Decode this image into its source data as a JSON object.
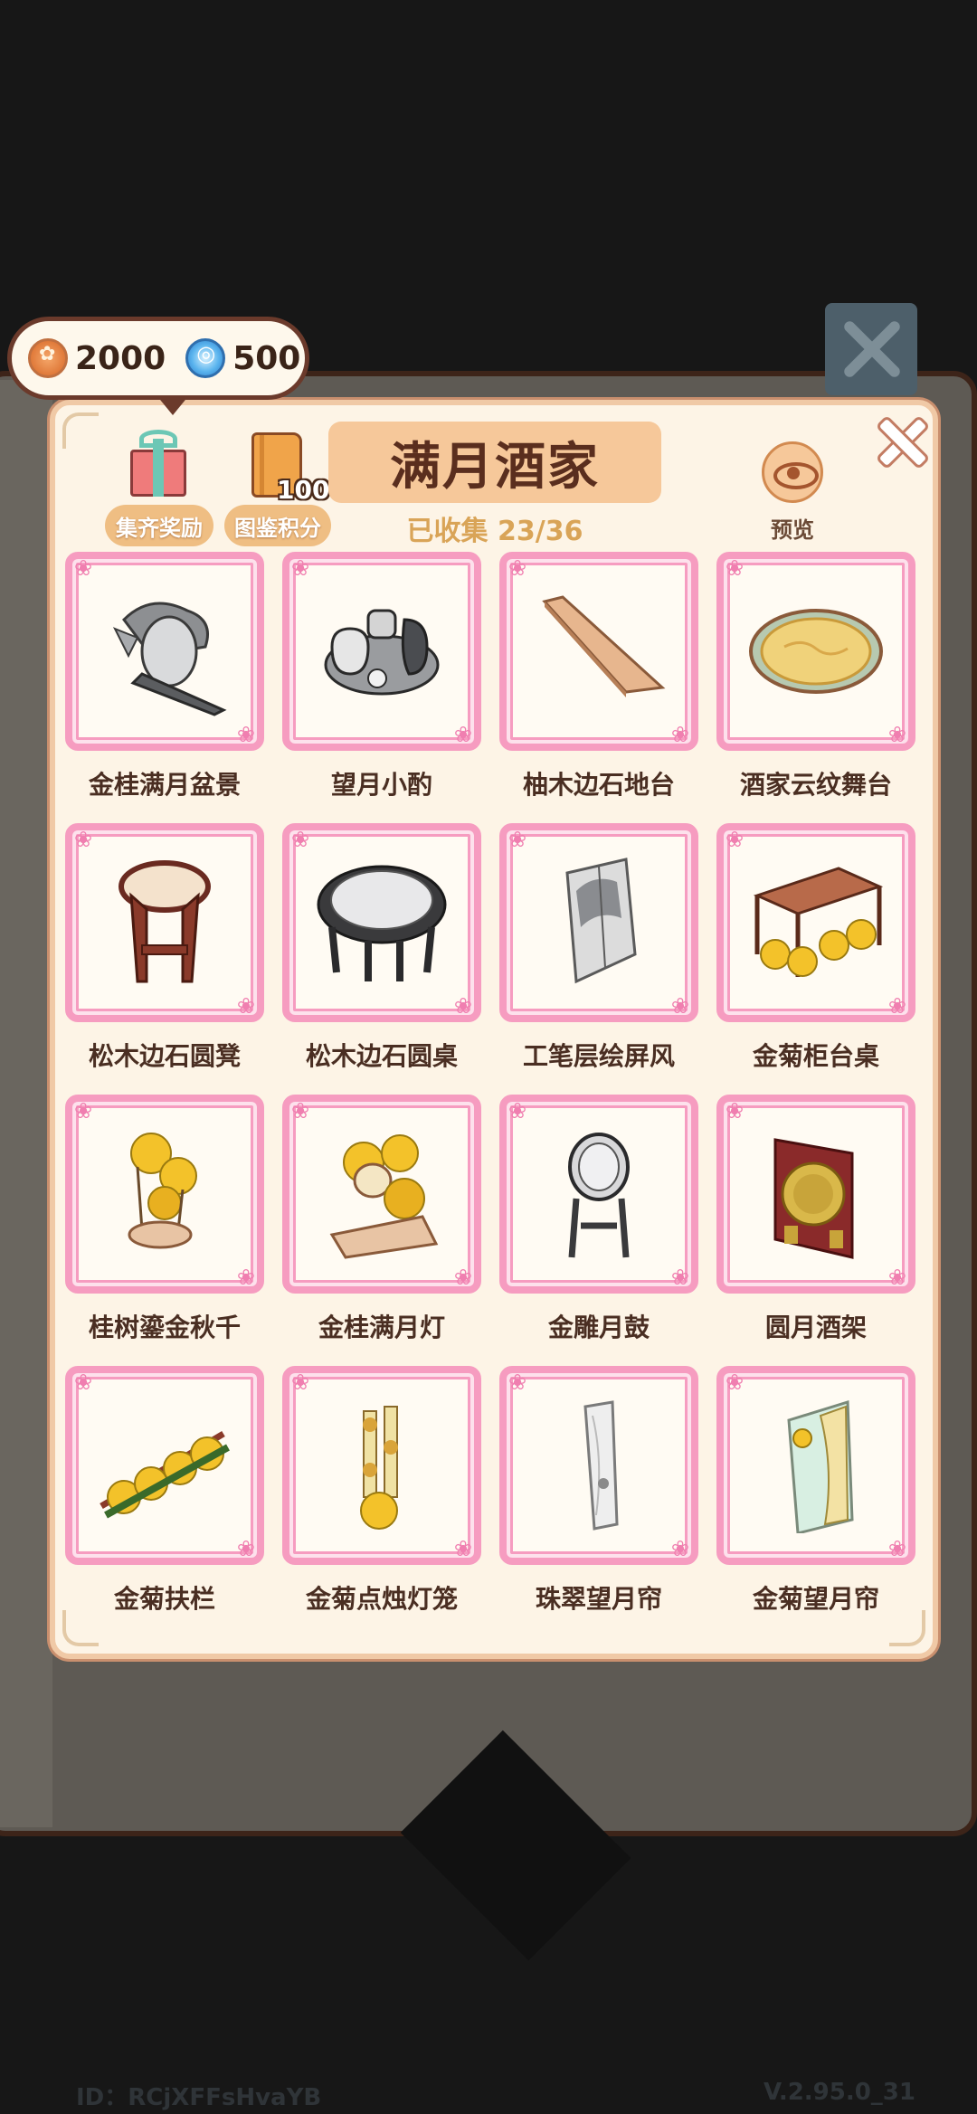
{
  "currency": {
    "coins": "2000",
    "gems": "500"
  },
  "header": {
    "reward_label": "集齐奖励",
    "book_count": "100",
    "points_label": "图鉴积分",
    "title": "满月酒家",
    "progress": "已收集 23/36",
    "preview_label": "预览"
  },
  "items": [
    {
      "label": "金桂满月盆景",
      "icon": "bonsai-screen-icon"
    },
    {
      "label": "望月小酌",
      "icon": "tea-set-icon"
    },
    {
      "label": "柚木边石地台",
      "icon": "wood-platform-icon"
    },
    {
      "label": "酒家云纹舞台",
      "icon": "round-stage-icon"
    },
    {
      "label": "松木边石圆凳",
      "icon": "round-stool-icon"
    },
    {
      "label": "松木边石圆桌",
      "icon": "round-table-icon"
    },
    {
      "label": "工笔层绘屏风",
      "icon": "folding-screen-icon"
    },
    {
      "label": "金菊柜台桌",
      "icon": "counter-table-icon"
    },
    {
      "label": "桂树鎏金秋千",
      "icon": "swing-icon"
    },
    {
      "label": "金桂满月灯",
      "icon": "moon-lamp-icon"
    },
    {
      "label": "金雕月鼓",
      "icon": "drum-icon"
    },
    {
      "label": "圆月酒架",
      "icon": "wine-rack-icon"
    },
    {
      "label": "金菊扶栏",
      "icon": "railing-icon"
    },
    {
      "label": "金菊点烛灯笼",
      "icon": "lantern-icon"
    },
    {
      "label": "珠翠望月帘",
      "icon": "white-curtain-icon"
    },
    {
      "label": "金菊望月帘",
      "icon": "gold-curtain-icon"
    }
  ],
  "footer": {
    "id": "ID：RCjXFFsHvaYB",
    "version": "V.2.95.0_31"
  },
  "colors": {
    "frame_pink": "#f69cc0",
    "panel_bg": "#fdf4e6",
    "title_bg": "#f6c89a"
  }
}
